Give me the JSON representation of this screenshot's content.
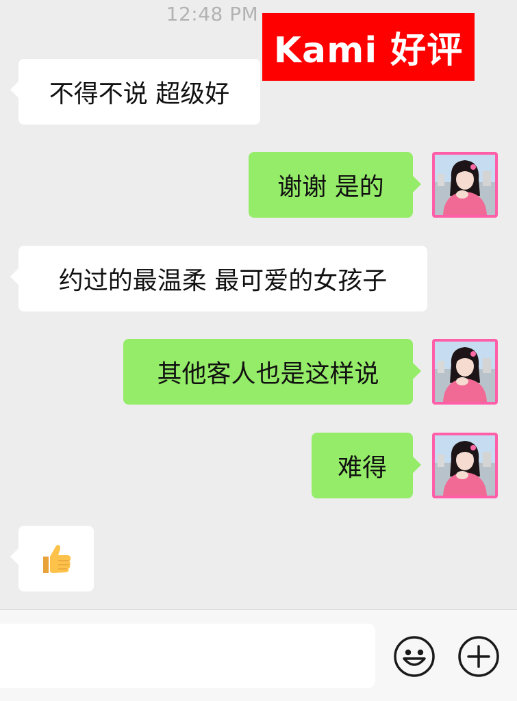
{
  "status": {
    "time": "12:48 PM"
  },
  "banner": {
    "text": "Kami 好评",
    "bg": "#ff0000"
  },
  "messages": [
    {
      "side": "left",
      "text": "不得不说 超级好"
    },
    {
      "side": "right",
      "text": "谢谢 是的"
    },
    {
      "side": "left",
      "text": "约过的最温柔 最可爱的女孩子"
    },
    {
      "side": "right",
      "text": "其他客人也是这样说"
    },
    {
      "side": "right",
      "text": "难得"
    },
    {
      "side": "left",
      "text": "👍",
      "icon": "thumbs-up-icon"
    }
  ],
  "input": {
    "value": "",
    "placeholder": ""
  },
  "toolbar": {
    "emoji_icon": "smiley-face-icon",
    "more_icon": "plus-circle-icon"
  },
  "colors": {
    "chat_bg": "#ededed",
    "sent_bubble": "#95ec69",
    "received_bubble": "#ffffff",
    "avatar_border": "#ff5fa8"
  }
}
